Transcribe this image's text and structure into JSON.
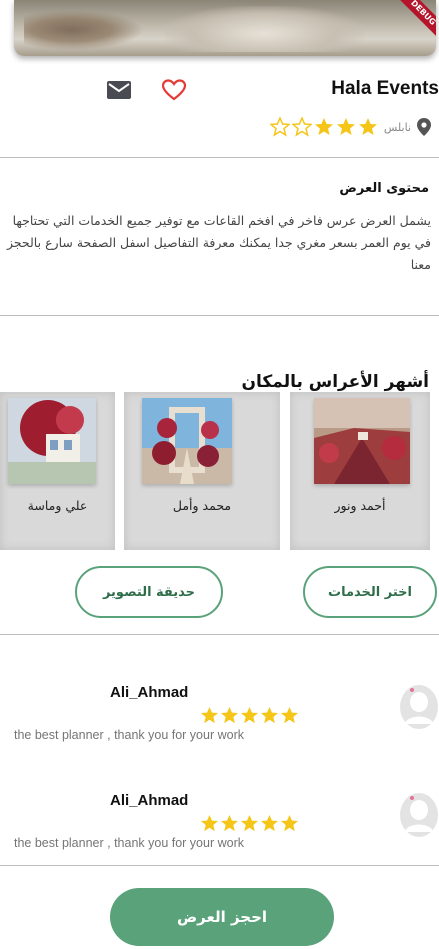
{
  "banner": {
    "debug_label": "DEBUG"
  },
  "venue": {
    "name": "Hala Events",
    "city": "نابلس",
    "rating": 3,
    "rating_max": 5
  },
  "offer": {
    "title": "محتوى العرض",
    "description": "يشمل العرض عرس فاخر في افخم القاعات  مع توفير جميع الخدمات التي تحتاجها في يوم العمر بسعر مغري جدا يمكنك معرفة التفاصيل اسفل الصفحة  سارع بالحجز معنا"
  },
  "weddings": {
    "title": "أشهر الأعراس بالمكان",
    "items": [
      {
        "name": "أحمد ونور"
      },
      {
        "name": "محمد وأمل"
      },
      {
        "name": "علي وماسة"
      }
    ]
  },
  "actions": {
    "choose_services": "اختر الخدمات",
    "photo_garden": "حديقة التصوير",
    "book_offer": "احجز العرض"
  },
  "reviews": [
    {
      "name": "Ali_Ahmad",
      "rating": 5,
      "text": "the best planner , thank you for your work"
    },
    {
      "name": "Ali_Ahmad",
      "rating": 5,
      "text": "the best planner , thank you for your work"
    }
  ],
  "colors": {
    "accent_green": "#5aa37a",
    "star_yellow": "#f5c518",
    "heart_red": "#e53935"
  }
}
